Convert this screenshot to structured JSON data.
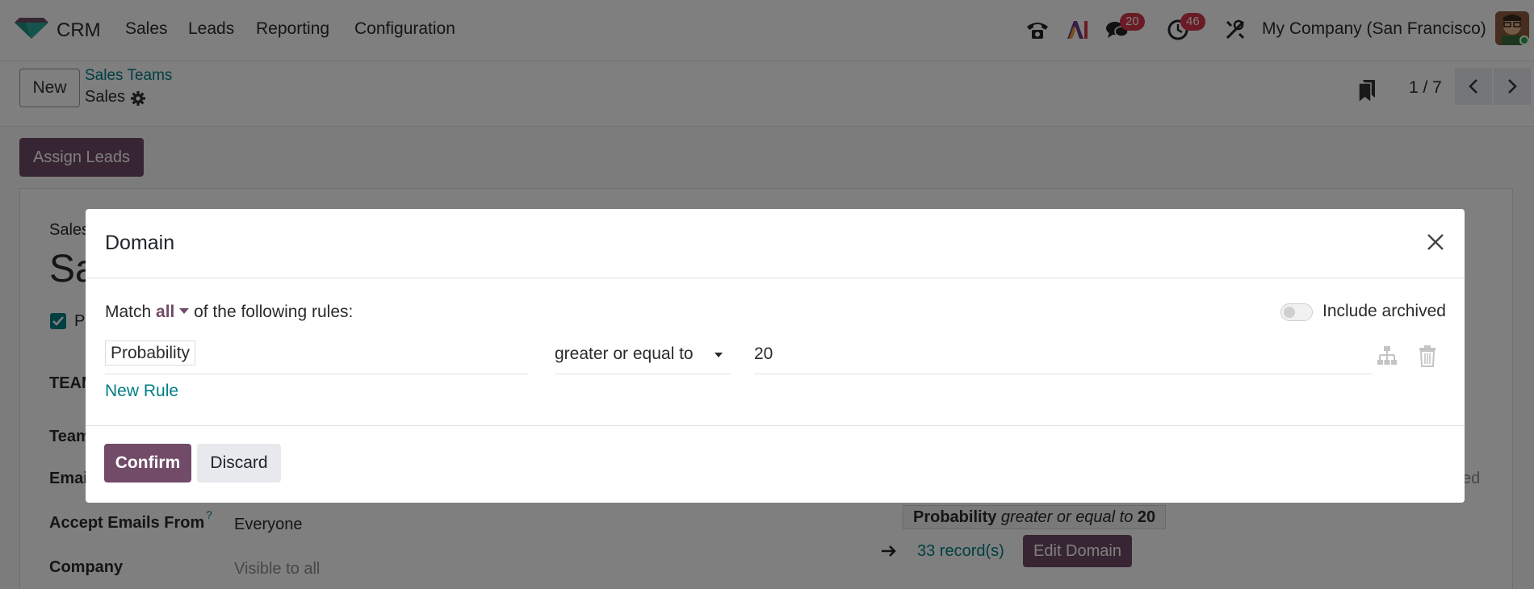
{
  "nav": {
    "app_name": "CRM",
    "menus": [
      "Sales",
      "Leads",
      "Reporting",
      "Configuration"
    ],
    "icons": [
      "phone-icon",
      "ai-icon",
      "chat-icon",
      "activity-clock-icon",
      "tools-icon"
    ],
    "chat_badge": "20",
    "activity_badge": "46",
    "company": "My Company (San Francisco)"
  },
  "control": {
    "new_label": "New",
    "breadcrumb_parent": "Sales Teams",
    "breadcrumb_current": "Sales",
    "pager": "1 / 7"
  },
  "form": {
    "assign_leads_label": "Assign Leads",
    "sales_team_label": "Sales",
    "team_name_partial": "Sa",
    "checkbox_label_partial": "P",
    "section_partial": "TEAM",
    "team_leader_partial": "Team",
    "email_alias_partial": "Emai",
    "accept_emails_label": "Accept Emails From",
    "accept_emails_help": "?",
    "accept_emails_value": "Everyone",
    "company_label": "Company",
    "company_placeholder": "Visible to all",
    "right_partial": "ed",
    "domain_field": "Probability",
    "domain_operator": "greater or equal to",
    "domain_value": "20",
    "records_count": "33 record(s)",
    "edit_domain_label": "Edit Domain"
  },
  "modal": {
    "title": "Domain",
    "match_prefix": "Match",
    "match_value": "all",
    "match_suffix": "of the following rules:",
    "include_archived_label": "Include archived",
    "include_archived": false,
    "rule": {
      "path": "Probability",
      "operator": "greater or equal to",
      "value": "20"
    },
    "new_rule_label": "New Rule",
    "confirm_label": "Confirm",
    "discard_label": "Discard"
  },
  "colors": {
    "brand": "#714b67",
    "link": "#017e84",
    "badge": "#d4374a"
  }
}
